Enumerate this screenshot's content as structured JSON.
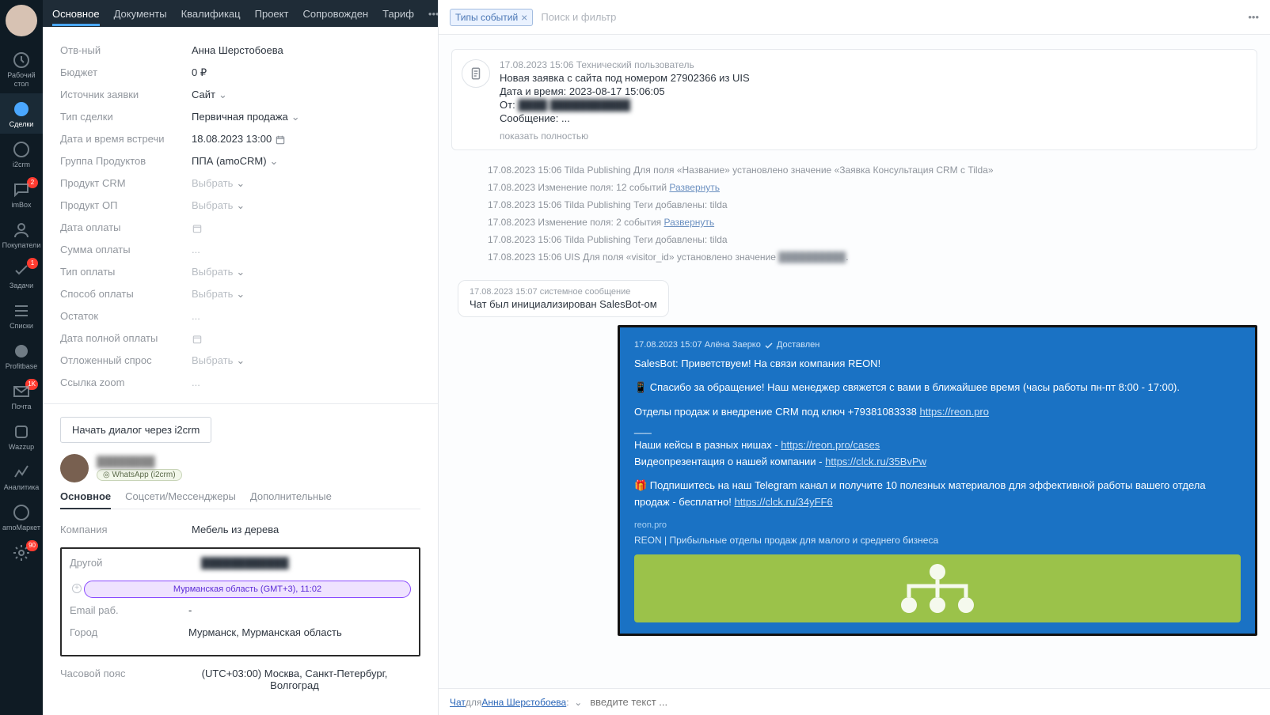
{
  "rail": [
    {
      "label": "Рабочий стол",
      "icon": "clock-icon"
    },
    {
      "label": "Сделки",
      "icon": "deals-icon",
      "active": true
    },
    {
      "label": "i2crm",
      "icon": "i2crm-icon"
    },
    {
      "label": "imBox",
      "icon": "chat-icon",
      "badge": "2"
    },
    {
      "label": "Покупатели",
      "icon": "buyers-icon"
    },
    {
      "label": "Задачи",
      "icon": "tasks-icon",
      "badge": "1"
    },
    {
      "label": "Списки",
      "icon": "lists-icon"
    },
    {
      "label": "Profitbase",
      "icon": "pb-icon"
    },
    {
      "label": "Почта",
      "icon": "mail-icon",
      "badge": "1K"
    },
    {
      "label": "Wazzup",
      "icon": "wz-icon"
    },
    {
      "label": "Аналитика",
      "icon": "analytics-icon"
    },
    {
      "label": "amoМаркет",
      "icon": "market-icon"
    },
    {
      "label": "",
      "icon": "gear-icon",
      "badge": "90"
    }
  ],
  "tabs": [
    "Основное",
    "Документы",
    "Квалификац",
    "Проект",
    "Сопровожден",
    "Тариф"
  ],
  "tabs_more": "•••",
  "fields": {
    "otv": {
      "l": "Отв-ный",
      "v": "Анна Шерстобоева"
    },
    "budget": {
      "l": "Бюджет",
      "v": "0 ₽"
    },
    "src": {
      "l": "Источник заявки",
      "v": "Сайт",
      "drop": true
    },
    "dealtype": {
      "l": "Тип сделки",
      "v": "Первичная продажа",
      "drop": true
    },
    "meet": {
      "l": "Дата и время встречи",
      "v": "18.08.2023 13:00",
      "cal": true
    },
    "pgroup": {
      "l": "Группа Продуктов",
      "v": "ППА (amoCRM)",
      "drop": true
    },
    "pcrm": {
      "l": "Продукт CRM",
      "v": "Выбрать",
      "drop": true,
      "muted": true
    },
    "pop": {
      "l": "Продукт ОП",
      "v": "Выбрать",
      "drop": true,
      "muted": true
    },
    "paydate": {
      "l": "Дата оплаты",
      "cal": true
    },
    "paysum": {
      "l": "Сумма оплаты",
      "v": "..."
    },
    "paytype": {
      "l": "Тип оплаты",
      "v": "Выбрать",
      "drop": true,
      "muted": true
    },
    "paymode": {
      "l": "Способ оплаты",
      "v": "Выбрать",
      "drop": true,
      "muted": true
    },
    "rest": {
      "l": "Остаток",
      "v": "..."
    },
    "fullpay": {
      "l": "Дата полной оплаты",
      "cal": true
    },
    "defer": {
      "l": "Отложенный спрос",
      "v": "Выбрать",
      "drop": true,
      "muted": true
    },
    "zoom": {
      "l": "Ссылка zoom",
      "v": "..."
    }
  },
  "i2btn": "Начать диалог через i2crm",
  "wa_badge": "◎ WhatsApp (i2crm)",
  "subtabs": [
    "Основное",
    "Соцсети/Мессенджеры",
    "Дополнительные"
  ],
  "contact": {
    "company": {
      "l": "Компания",
      "v": "Мебель из дерева"
    },
    "other": {
      "l": "Другой"
    },
    "chip": "Мурманская область (GMT+3), 11:02",
    "email": {
      "l": "Email раб.",
      "v": "-"
    },
    "city": {
      "l": "Город",
      "v": "Мурманск, Мурманская область"
    },
    "tz": {
      "l": "Часовой пояс",
      "v": "(UTC+03:00) Москва, Санкт-Петербург, Волгоград"
    }
  },
  "feed": {
    "tag": "Типы событий",
    "search": "Поиск и фильтр",
    "card": {
      "meta": "17.08.2023 15:06 Технический пользователь",
      "l1": "Новая заявка с сайта под номером 27902366 из UIS",
      "l2": "Дата и время: 2023-08-17 15:06:05",
      "l3": "От:",
      "l4": "Сообщение: ...",
      "show": "показать полностью"
    },
    "log": [
      "17.08.2023 15:06 Tilda Publishing Для поля «Название» установлено значение «Заявка Консультация CRM с Tilda»",
      "17.08.2023 Изменение поля: 12 событий ",
      "17.08.2023 15:06 Tilda Publishing Теги добавлены: tilda",
      "17.08.2023 Изменение поля: 2 события ",
      "17.08.2023 15:06 Tilda Publishing Теги добавлены: tilda",
      "17.08.2023 15:06 UIS Для поля «visitor_id» установлено значение "
    ],
    "expand": "Развернуть",
    "bubble": {
      "meta": "17.08.2023 15:07 системное сообщение",
      "txt": "Чат был инициализирован SalesBot-ом"
    },
    "chat": {
      "meta": "17.08.2023 15:07 Алёна Заерко",
      "status": "Доставлен",
      "p1": "SalesBot: Приветствуем! На связи компания REON!",
      "p2": "📱 Спасибо за обращение! Наш менеджер свяжется с вами в ближайшее время (часы работы пн-пт 8:00 - 17:00).",
      "p3": "Отделы продаж и внедрение CRM под ключ +79381083338 ",
      "p3l": "https://reon.pro",
      "dash": "___",
      "p4a": "Наши кейсы в разных нишах - ",
      "p4l": "https://reon.pro/cases",
      "p5a": "Видеопрезентация о нашей компании - ",
      "p5l": "https://clck.ru/35BvPw",
      "p6a": "🎁 Подпишитесь на наш Telegram канал и получите 10 полезных материалов для эффективной работы вашего отдела продаж - бесплатно! ",
      "p6l": "https://clck.ru/34yFF6",
      "site": "reon.pro",
      "desc": "REON | Прибыльные отделы продаж для малого и среднего бизнеса"
    },
    "foot": {
      "chat": "Чат",
      "for": " для ",
      "user": "Анна Шерстобоева",
      "ph": "введите текст ..."
    }
  }
}
